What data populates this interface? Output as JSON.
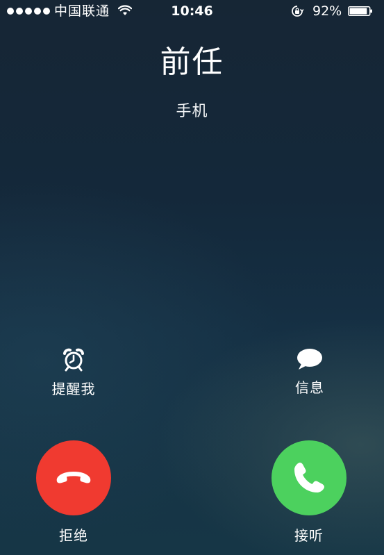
{
  "status_bar": {
    "carrier": "中国联通",
    "time": "10:46",
    "battery": "92%",
    "battery_level": 0.92,
    "signal_bars": 5,
    "icons": [
      "signal-dots-icon",
      "wifi-icon",
      "rotation-lock-icon",
      "battery-icon"
    ]
  },
  "call": {
    "caller_name": "前任",
    "caller_type": "手机"
  },
  "actions": {
    "remind": {
      "label": "提醒我",
      "icon": "alarm-clock-icon"
    },
    "message": {
      "label": "信息",
      "icon": "speech-bubble-icon"
    }
  },
  "buttons": {
    "decline": {
      "label": "拒绝",
      "icon": "phone-hangup-icon",
      "color": "#f03a30"
    },
    "accept": {
      "label": "接听",
      "icon": "phone-icon",
      "color": "#4cd15e"
    }
  }
}
